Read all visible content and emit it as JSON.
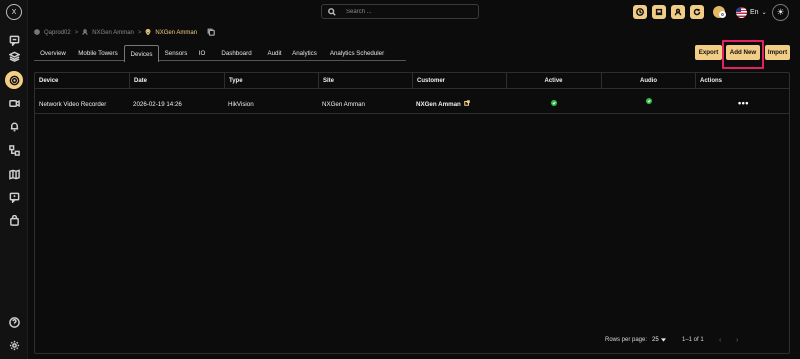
{
  "app": {
    "logo_glyph": "X"
  },
  "rail": {
    "items": [
      {
        "name": "chat-icon"
      },
      {
        "name": "layers-icon"
      },
      {
        "name": "device-settings-icon",
        "active": true
      },
      {
        "name": "video-camera-icon"
      },
      {
        "name": "bell-icon"
      },
      {
        "name": "hierarchy-icon"
      },
      {
        "name": "map-icon"
      },
      {
        "name": "message-alert-icon"
      },
      {
        "name": "bag-icon"
      }
    ],
    "bottom": [
      {
        "name": "help-icon"
      },
      {
        "name": "settings-icon"
      }
    ]
  },
  "topbar": {
    "search_placeholder": "Search ...",
    "buttons": [
      "clock-icon",
      "laptop-icon",
      "user-icon",
      "refresh-icon",
      "calendar-icon"
    ],
    "notification_count": "0",
    "language": "En",
    "theme_icon": "sun-icon"
  },
  "breadcrumb": {
    "items": [
      "Qaprod02",
      "NXGen Amman",
      "NXGen Amman"
    ],
    "separator": ">"
  },
  "tabs": [
    {
      "label": "Overview"
    },
    {
      "label": "Mobile Towers"
    },
    {
      "label": "Devices",
      "selected": true
    },
    {
      "label": "Sensors"
    },
    {
      "label": "IO"
    },
    {
      "label": "Dashboard"
    },
    {
      "label": "Audit"
    },
    {
      "label": "Analytics"
    },
    {
      "label": "Analytics Scheduler"
    }
  ],
  "actions": {
    "export": "Export",
    "add_new": "Add New",
    "import": "Import"
  },
  "table": {
    "columns": [
      "Device",
      "Date",
      "Type",
      "Site",
      "Customer",
      "Active",
      "Audio",
      "Actions"
    ],
    "rows": [
      {
        "device": "Network Video Recorder",
        "date": "2026-02-19 14:26",
        "type": "HikVision",
        "site": "NXGen Amman",
        "customer": "NXGen Amman",
        "active": true,
        "audio": true,
        "actions": "•••"
      }
    ]
  },
  "pagination": {
    "rows_per_page_label": "Rows per page:",
    "rows_per_page": "25",
    "range": "1–1 of 1",
    "prev": "‹",
    "next": "›"
  },
  "colors": {
    "accent": "#f1cd86",
    "highlight": "#e0245e",
    "status_ok": "#2fbf4a",
    "background": "#0c0c0c"
  }
}
